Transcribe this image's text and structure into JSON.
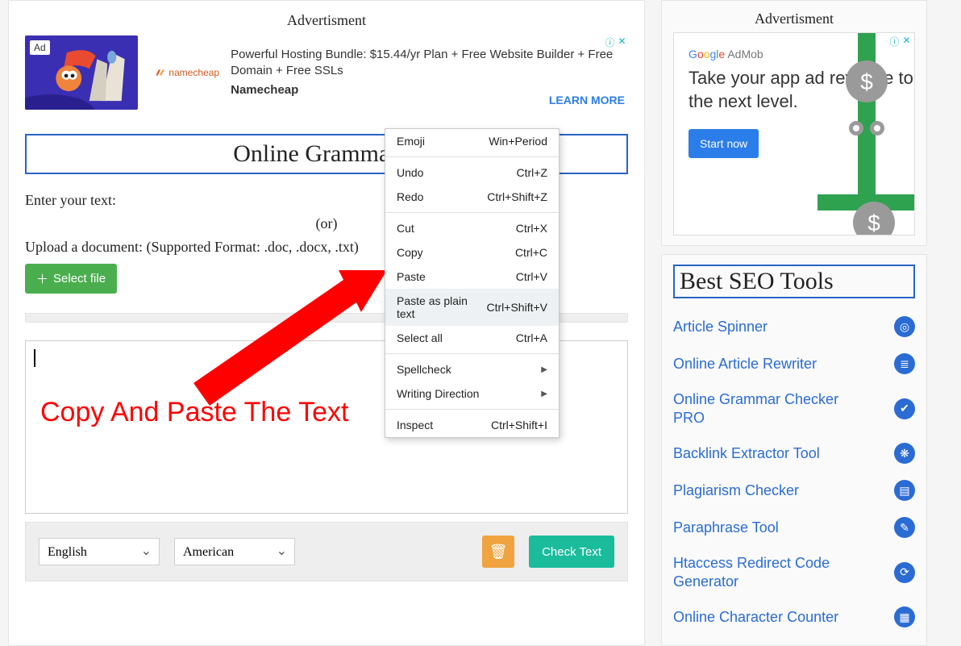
{
  "main": {
    "ad_label": "Advertisment",
    "ad_badge": "Ad",
    "ad_logo": "namecheap",
    "ad_headline": "Powerful Hosting Bundle: $15.44/yr Plan + Free Website Builder + Free Domain + Free SSLs",
    "ad_brand": "Namecheap",
    "ad_cta": "LEARN MORE",
    "title": "Online Grammar C",
    "enter_label": "Enter your text:",
    "or": "(or)",
    "upload_label": "Upload a document: (Supported Format: .doc, .docx, .txt)",
    "select_file": "Select file",
    "language": "English",
    "variant": "American",
    "check": "Check Text"
  },
  "context_menu": [
    {
      "label": "Emoji",
      "shortcut": "Win+Period",
      "type": "item"
    },
    {
      "type": "sep"
    },
    {
      "label": "Undo",
      "shortcut": "Ctrl+Z",
      "type": "item"
    },
    {
      "label": "Redo",
      "shortcut": "Ctrl+Shift+Z",
      "type": "item"
    },
    {
      "type": "sep"
    },
    {
      "label": "Cut",
      "shortcut": "Ctrl+X",
      "type": "item"
    },
    {
      "label": "Copy",
      "shortcut": "Ctrl+C",
      "type": "item"
    },
    {
      "label": "Paste",
      "shortcut": "Ctrl+V",
      "type": "item"
    },
    {
      "label": "Paste as plain text",
      "shortcut": "Ctrl+Shift+V",
      "type": "item",
      "hover": true
    },
    {
      "label": "Select all",
      "shortcut": "Ctrl+A",
      "type": "item"
    },
    {
      "type": "sep"
    },
    {
      "label": "Spellcheck",
      "shortcut": "",
      "type": "submenu"
    },
    {
      "label": "Writing Direction",
      "shortcut": "",
      "type": "submenu"
    },
    {
      "type": "sep"
    },
    {
      "label": "Inspect",
      "shortcut": "Ctrl+Shift+I",
      "type": "item"
    }
  ],
  "annotation": "Copy And Paste The Text",
  "sidebar": {
    "ad_label": "Advertisment",
    "admob_logo": "Google AdMob",
    "admob_text": "Take your app ad revenue to the next level.",
    "admob_cta": "Start now",
    "seo_title": "Best SEO Tools",
    "tools": [
      {
        "name": "Article Spinner",
        "icon": "◎"
      },
      {
        "name": "Online Article Rewriter",
        "icon": "≣"
      },
      {
        "name": "Online Grammar Checker PRO",
        "icon": "✔"
      },
      {
        "name": "Backlink Extractor Tool",
        "icon": "❋"
      },
      {
        "name": "Plagiarism Checker",
        "icon": "▤"
      },
      {
        "name": "Paraphrase Tool",
        "icon": "✎"
      },
      {
        "name": "Htaccess Redirect Code Generator",
        "icon": "⟳"
      },
      {
        "name": "Online Character Counter",
        "icon": "▦"
      }
    ]
  }
}
